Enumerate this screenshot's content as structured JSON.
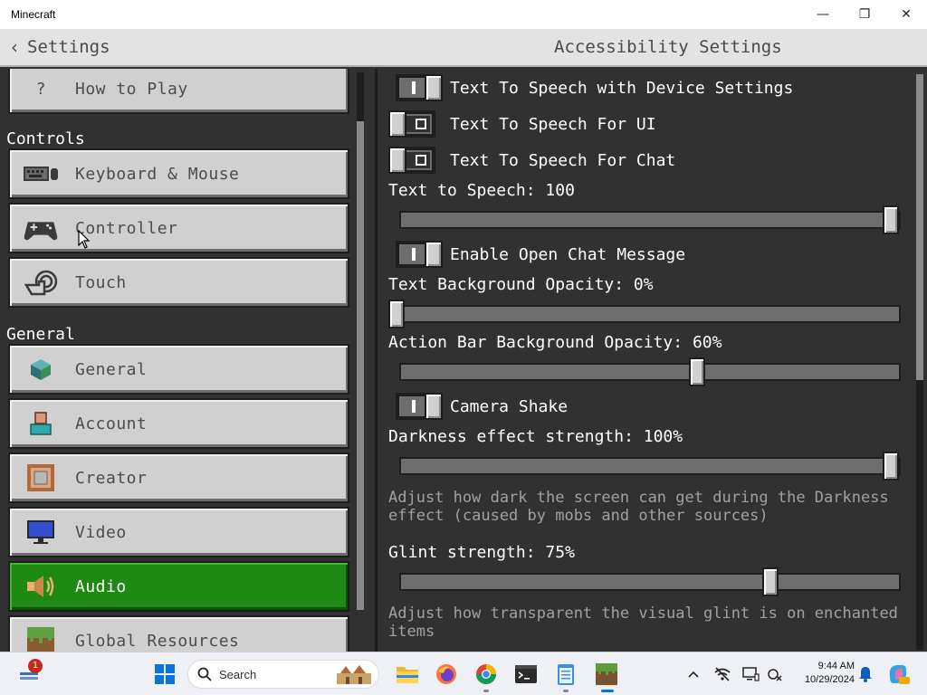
{
  "window": {
    "title": "Minecraft",
    "minimize": "—",
    "restore": "❐",
    "close": "✕"
  },
  "header": {
    "back_label": "Settings",
    "screen_title": "Accessibility Settings"
  },
  "left_panel": {
    "sections": {
      "controls": "Controls",
      "general": "General"
    },
    "items": [
      {
        "label": "How to Play",
        "icon": "question-icon",
        "glyph": "?"
      },
      {
        "label": "Keyboard & Mouse",
        "icon": "keyboard-icon"
      },
      {
        "label": "Controller",
        "icon": "controller-icon"
      },
      {
        "label": "Touch",
        "icon": "touch-icon"
      },
      {
        "label": "General",
        "icon": "cube-icon"
      },
      {
        "label": "Account",
        "icon": "account-icon"
      },
      {
        "label": "Creator",
        "icon": "creator-icon"
      },
      {
        "label": "Video",
        "icon": "monitor-icon"
      },
      {
        "label": "Audio",
        "icon": "speaker-icon",
        "selected": true
      },
      {
        "label": "Global Resources",
        "icon": "grass-block-icon"
      }
    ]
  },
  "settings": {
    "tts_device": {
      "label": "Text To Speech with Device Settings",
      "state": "on"
    },
    "tts_ui": {
      "label": "Text To Speech For UI",
      "state": "off"
    },
    "tts_chat": {
      "label": "Text To Speech For Chat",
      "state": "off"
    },
    "tts_volume": {
      "label": "Text to Speech: 100",
      "value": 1.0
    },
    "open_chat": {
      "label": "Enable Open Chat Message",
      "state": "on"
    },
    "text_bg_opacity": {
      "label": "Text Background Opacity: 0%",
      "value": 0.0
    },
    "action_bar_opacity": {
      "label": "Action Bar Background Opacity: 60%",
      "value": 0.6
    },
    "camera_shake": {
      "label": "Camera Shake",
      "state": "on"
    },
    "darkness": {
      "label": "Darkness effect strength: 100%",
      "value": 1.0,
      "hint": "Adjust how dark the screen can get during the Darkness effect (caused by mobs and other sources)"
    },
    "glint": {
      "label": "Glint strength: 75%",
      "value": 0.75,
      "hint": "Adjust how transparent the visual glint is on enchanted items"
    }
  },
  "taskbar": {
    "notification_count": "1",
    "search_placeholder": "Search",
    "time": "9:44 AM",
    "date": "10/29/2024",
    "apps": [
      "start-icon",
      "file-explorer-icon",
      "firefox-icon",
      "chrome-icon",
      "terminal-icon",
      "notepad-icon",
      "minecraft-icon"
    ],
    "tray": [
      "chevron-up-icon",
      "network-off-icon",
      "display-icon",
      "accessibility-icon",
      "bell-icon",
      "copilot-icon"
    ]
  },
  "colors": {
    "selected_green": "#1e8a13",
    "panel_bg": "#313131",
    "button_gray": "#d0d0d0",
    "taskbar_bg": "#eef0f5"
  }
}
